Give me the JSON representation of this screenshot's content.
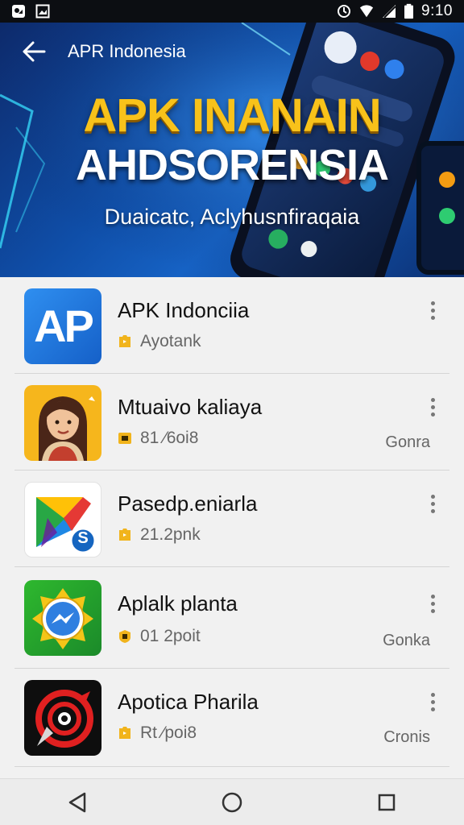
{
  "status_bar": {
    "time": "9:10"
  },
  "appbar": {
    "title": "APR Indonesia"
  },
  "hero": {
    "line1": "APK INANAIN",
    "line2": "AHDSORENSIA",
    "subtitle": "Duaicatc, Aclyhusnfiraqaia"
  },
  "apps": [
    {
      "name": "APK Indonciia",
      "meta": "Ayotank",
      "tag": "",
      "icon_text": "AP"
    },
    {
      "name": "Mtuaivo kaliaya",
      "meta": "81 ⁄6oi8",
      "tag": "Gonra"
    },
    {
      "name": "Pasedp.eniarla",
      "meta": "21.2pnk",
      "tag": "",
      "icon_text": "S"
    },
    {
      "name": "Aplalk planta",
      "meta": "01 2poit",
      "tag": "Gonka"
    },
    {
      "name": "Apotica Pharila",
      "meta": "Rt ⁄poi8",
      "tag": "Cronis"
    }
  ],
  "colors": {
    "accent_yellow": "#f8c21a",
    "hero_blue": "#0f4ea8",
    "badge_orange": "#f1b41c"
  }
}
